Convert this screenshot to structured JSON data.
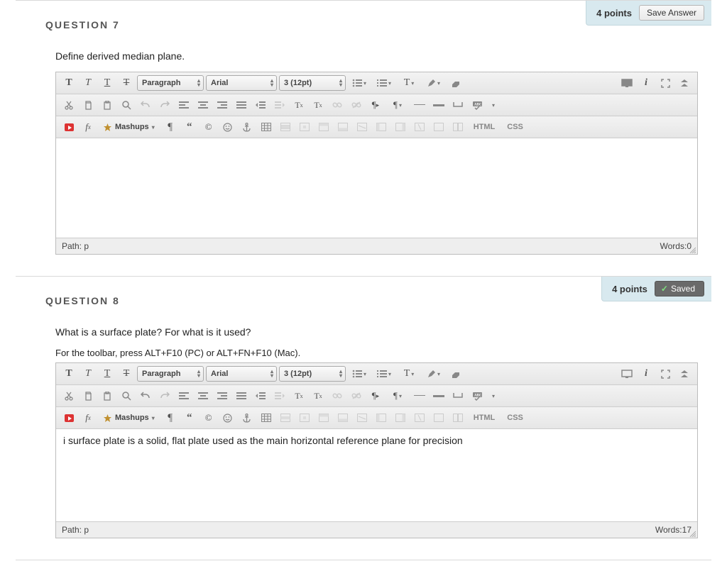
{
  "questions": [
    {
      "label": "QUESTION 7",
      "points": "4 points",
      "save_label": "Save Answer",
      "saved": false,
      "prompt": "Define derived median plane.",
      "toolbar_hint": "",
      "content": "",
      "path_label": "Path:",
      "path_value": "p",
      "words_label": "Words:",
      "words_value": "0"
    },
    {
      "label": "QUESTION 8",
      "points": "4 points",
      "save_label": "Saved",
      "saved": true,
      "prompt": "What is a surface plate? For what is it used?",
      "toolbar_hint": "For the toolbar, press ALT+F10 (PC) or ALT+FN+F10 (Mac).",
      "content": "i surface plate is a solid, flat plate used as the main horizontal reference plane for precision",
      "path_label": "Path:",
      "path_value": "p",
      "words_label": "Words:",
      "words_value": "17"
    }
  ],
  "editor": {
    "format": "Paragraph",
    "font": "Arial",
    "size": "3 (12pt)",
    "mashups": "Mashups",
    "html": "HTML",
    "css": "CSS"
  }
}
